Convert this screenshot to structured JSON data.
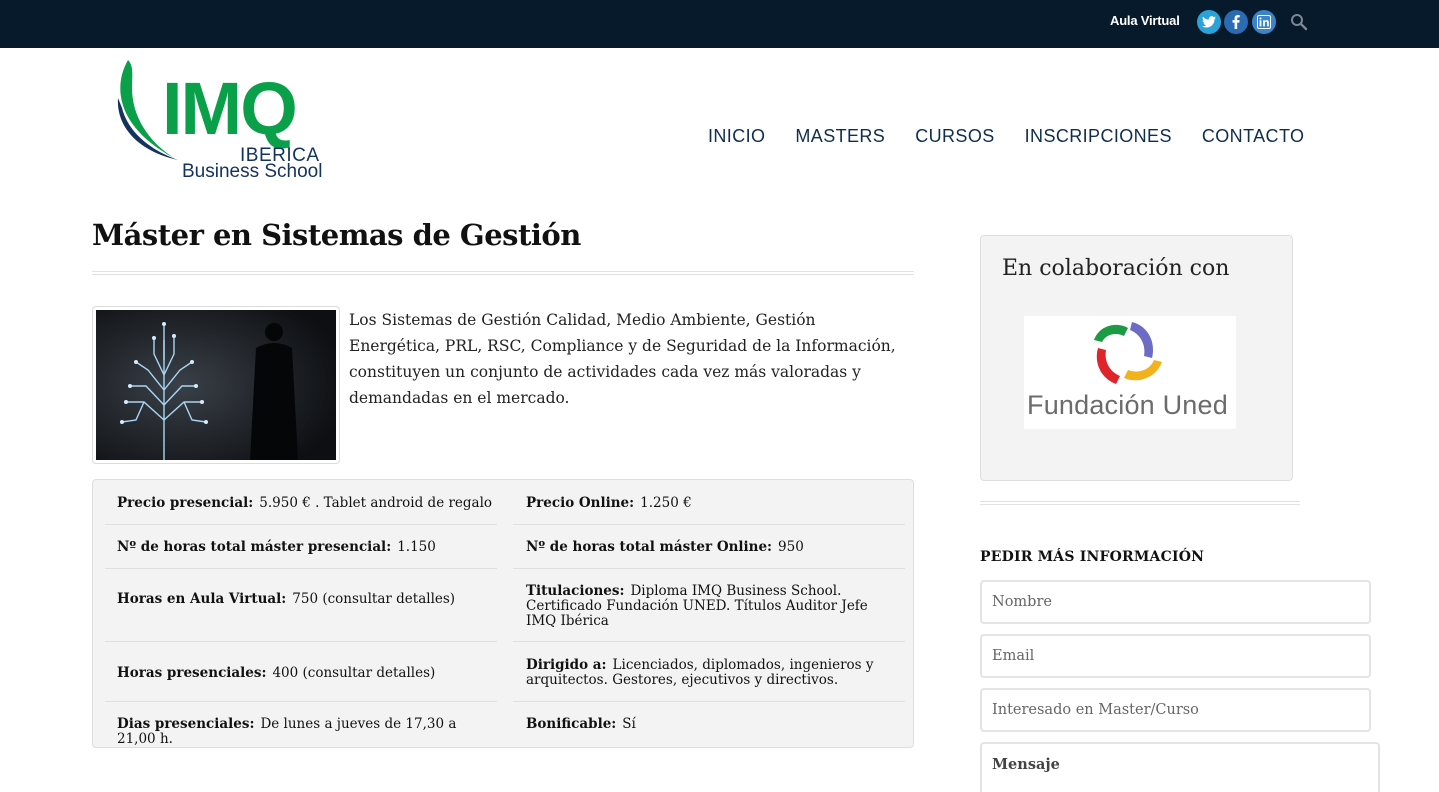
{
  "topbar": {
    "aula_virtual": "Aula Virtual",
    "social": [
      "twitter-icon",
      "facebook-icon",
      "linkedin-icon"
    ],
    "search_icon": "search-icon"
  },
  "logo": {
    "mark": "IMQ",
    "line1": "IBERICA",
    "line2": "Business School",
    "colors": {
      "green": "#0aa04a",
      "navy": "#14325e"
    }
  },
  "nav": {
    "items": [
      "INICIO",
      "MASTERS",
      "CURSOS",
      "INSCRIPCIONES",
      "CONTACTO"
    ]
  },
  "main": {
    "title": "Máster en Sistemas de Gestión",
    "intro": "Los Sistemas de Gestión Calidad, Medio Ambiente, Gestión Energética, PRL, RSC, Compliance y de Seguridad de la Información, constituyen un conjunto de actividades cada vez más valoradas y demandadas en el mercado.",
    "details": [
      {
        "label": "Precio presencial:",
        "value": "5.950 € . Tablet android de regalo"
      },
      {
        "label": "Precio Online:",
        "value": "1.250 €"
      },
      {
        "label": "Nº de horas total máster presencial:",
        "value": "1.150"
      },
      {
        "label": "Nº de horas total máster Online:",
        "value": "950"
      },
      {
        "label": "Horas en Aula Virtual:",
        "value": "750 (consultar detalles)"
      },
      {
        "label": "Titulaciones:",
        "value": "Diploma IMQ Business School. Certificado Fundación UNED. Títulos Auditor Jefe IMQ Ibérica"
      },
      {
        "label": "Horas presenciales:",
        "value": "400 (consultar detalles)"
      },
      {
        "label": "Dirigido a:",
        "value": "Licenciados, diplomados, ingenieros y arquitectos. Gestores, ejecutivos y directivos."
      },
      {
        "label": "Dias presenciales:",
        "value": "De lunes a jueves de 17,30 a 21,00 h."
      },
      {
        "label": "Bonificable:",
        "value": "Sí"
      }
    ]
  },
  "sidebar": {
    "collab_title": "En colaboración con",
    "partner_name": "Fundación Uned",
    "form_title": "PEDIR MÁS INFORMACIÓN",
    "fields": {
      "name_placeholder": "Nombre",
      "email_placeholder": "Email",
      "interest_placeholder": "Interesado en Master/Curso",
      "message_placeholder": "Mensaje"
    }
  }
}
